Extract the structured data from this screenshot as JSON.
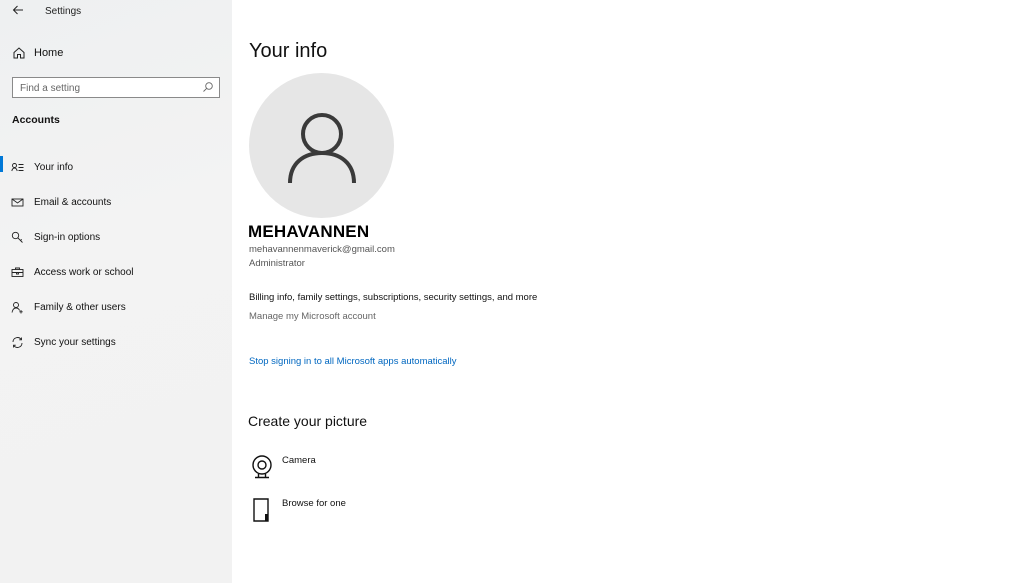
{
  "window": {
    "title": "Settings"
  },
  "sidebar": {
    "home_label": "Home",
    "search_placeholder": "Find a setting",
    "section_title": "Accounts",
    "items": [
      {
        "label": "Your info",
        "icon": "your-info-icon",
        "active": true
      },
      {
        "label": "Email & accounts",
        "icon": "mail-icon",
        "active": false
      },
      {
        "label": "Sign-in options",
        "icon": "key-icon",
        "active": false
      },
      {
        "label": "Access work or school",
        "icon": "briefcase-icon",
        "active": false
      },
      {
        "label": "Family & other users",
        "icon": "add-person-icon",
        "active": false
      },
      {
        "label": "Sync your settings",
        "icon": "sync-icon",
        "active": false
      }
    ]
  },
  "main": {
    "title": "Your info",
    "user": {
      "name": "MEHAVANNEN",
      "email": "mehavannenmaverick@gmail.com",
      "role": "Administrator"
    },
    "billing_text": "Billing info, family settings, subscriptions, security settings, and more",
    "manage_link": "Manage my Microsoft account",
    "stop_signing_link": "Stop signing in to all Microsoft apps automatically",
    "create_picture": {
      "title": "Create your picture",
      "options": [
        {
          "label": "Camera",
          "icon": "camera-icon"
        },
        {
          "label": "Browse for one",
          "icon": "browse-icon"
        }
      ]
    }
  },
  "colors": {
    "accent": "#0078d7",
    "link": "#0067c0",
    "avatar_bg": "#e6e6e6"
  }
}
